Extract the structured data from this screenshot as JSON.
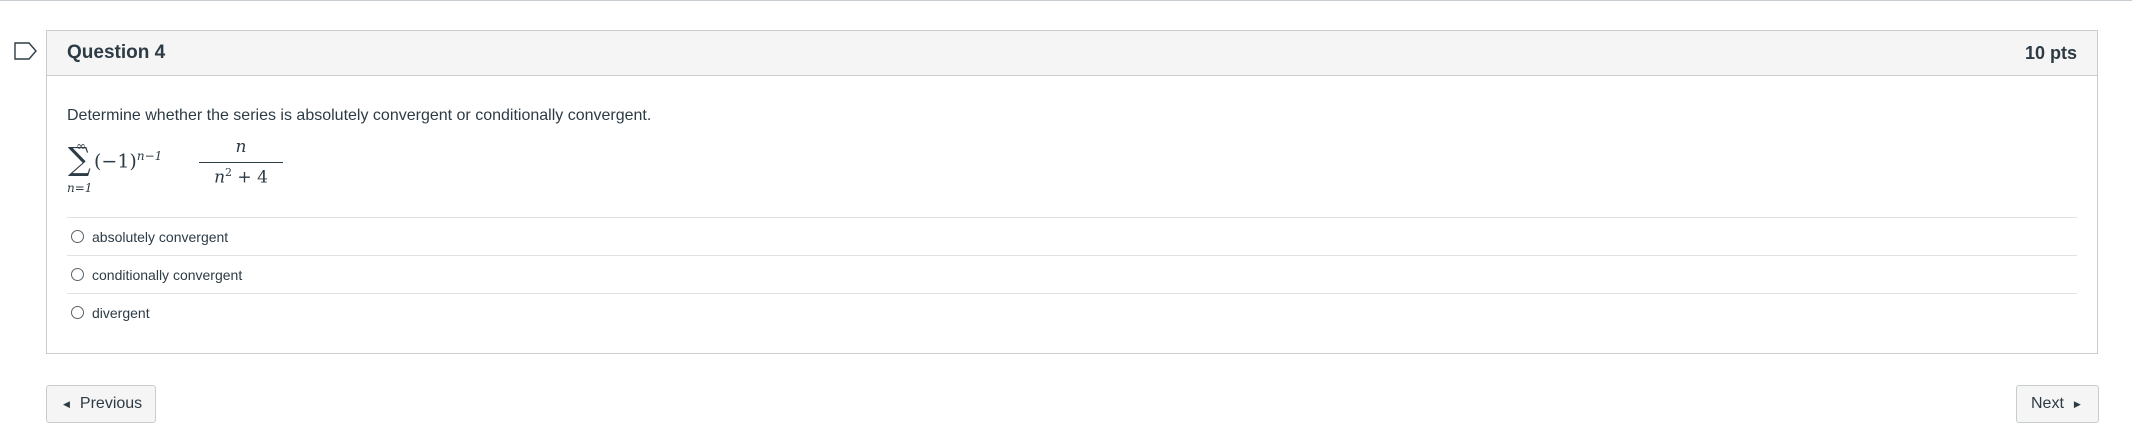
{
  "question": {
    "title": "Question 4",
    "points": "10 pts",
    "prompt": "Determine whether the series is absolutely convergent or conditionally convergent.",
    "formula": {
      "sum_upper": "∞",
      "sum_symbol": "∑",
      "sum_lower": "n=1",
      "term_base": "(−1)",
      "term_exponent": "n−1",
      "numerator": "n",
      "denominator_var": "n",
      "denominator_exponent": "2",
      "denominator_rest": " + 4"
    },
    "answers": [
      {
        "label": "absolutely convergent",
        "selected": false
      },
      {
        "label": "conditionally convergent",
        "selected": false
      },
      {
        "label": "divergent",
        "selected": false
      }
    ]
  },
  "navigation": {
    "previous_label": "Previous",
    "next_label": "Next",
    "previous_icon": "triangle-left-icon",
    "next_icon": "triangle-right-icon"
  },
  "flag_icon": "bookmark-flag-icon",
  "colors": {
    "text": "#2d3b45",
    "border": "#c7cdd1",
    "header_bg": "#f5f5f5"
  }
}
